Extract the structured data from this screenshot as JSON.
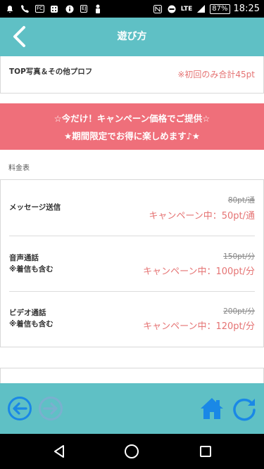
{
  "status_bar": {
    "left_icons": [
      "notification-icon",
      "call-icon",
      "fc-icon",
      "dice-icon",
      "info-icon",
      "app-icon",
      "person-icon"
    ],
    "fc_label": "FC",
    "app_label": "EJ",
    "network": "LTE",
    "battery": "87%",
    "time": "18:25"
  },
  "header": {
    "title": "遊び方"
  },
  "top_item": {
    "label": "TOP写真＆その他プロフ",
    "value": "※初回のみ合計45pt"
  },
  "banner": {
    "line1": "☆今だけ！キャンペーン価格でご提供☆",
    "line2": "★期間限定でお得に楽しめます♪★"
  },
  "section_label": "料金表",
  "price_rows": [
    {
      "name_line1": "メッセージ送信",
      "name_line2": "",
      "old_price": "80pt/通",
      "new_price": "キャンペーン中：50pt/通"
    },
    {
      "name_line1": "音声通話",
      "name_line2": "※着信も含む",
      "old_price": "150pt/分",
      "new_price": "キャンペーン中：100pt/分"
    },
    {
      "name_line1": "ビデオ通話",
      "name_line2": "※着信も含む",
      "old_price": "200pt/分",
      "new_price": "キャンペーン中：120pt/分"
    }
  ],
  "colors": {
    "teal": "#5fc0c5",
    "banner_red": "#ef6f7a",
    "price_red": "#e57373",
    "footer_blue": "#1a88e6"
  }
}
